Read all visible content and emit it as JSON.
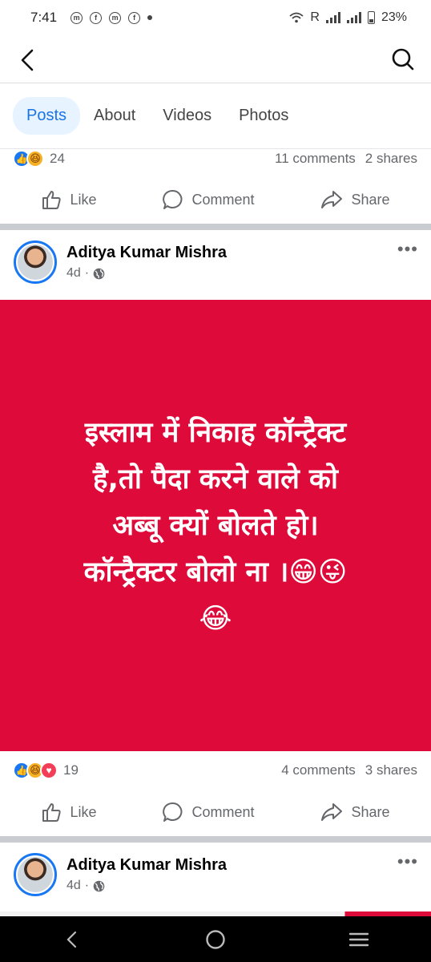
{
  "status_bar": {
    "time": "7:41",
    "battery": "23%",
    "network_label": "R"
  },
  "top_bar": {
    "back_icon": "chevron-left-icon",
    "search_icon": "search-icon"
  },
  "tabs": [
    {
      "label": "Posts",
      "active": true
    },
    {
      "label": "About",
      "active": false
    },
    {
      "label": "Videos",
      "active": false
    },
    {
      "label": "Photos",
      "active": false
    }
  ],
  "previous_post": {
    "reaction_count": "24",
    "comments": "11 comments",
    "shares": "2 shares",
    "actions": {
      "like": "Like",
      "comment": "Comment",
      "share": "Share"
    }
  },
  "post": {
    "author": "Aditya Kumar Mishra",
    "time": "4d",
    "image_text_lines": [
      "इस्लाम में निकाह कॉन्ट्रैक्ट",
      "है,तो पैदा करने वाले को",
      "अब्बू क्यों बोलते हो।",
      "कॉन्ट्रैक्टर बोलो ना ।😁😜",
      "😂"
    ],
    "image_bg_color": "#dd0a3a",
    "reaction_count": "19",
    "comments": "4 comments",
    "shares": "3 shares",
    "actions": {
      "like": "Like",
      "comment": "Comment",
      "share": "Share"
    }
  },
  "next_post": {
    "author": "Aditya Kumar Mishra",
    "time": "4d"
  },
  "colors": {
    "accent": "#1b74e4",
    "tab_active_bg": "#e7f3ff",
    "secondary_text": "#65676b"
  }
}
